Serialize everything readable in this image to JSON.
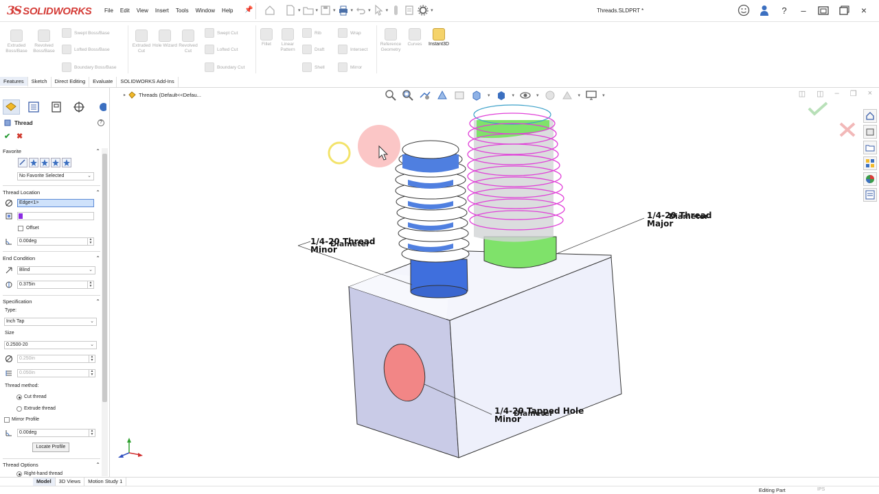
{
  "app": {
    "logo_mark": "3S",
    "logo_text": "SOLIDWORKS",
    "document_title": "Threads.SLDPRT *"
  },
  "menu": [
    "File",
    "Edit",
    "View",
    "Insert",
    "Tools",
    "Window",
    "Help"
  ],
  "command_manager": {
    "extruded_boss": "Extruded Boss/Base",
    "revolved_boss": "Revolved Boss/Base",
    "swept_boss": "Swept Boss/Base",
    "lofted_boss": "Lofted Boss/Base",
    "boundary_boss": "Boundary Boss/Base",
    "extruded_cut": "Extruded Cut",
    "hole_wizard": "Hole Wizard",
    "revolved_cut": "Revolved Cut",
    "swept_cut": "Swept Cut",
    "lofted_cut": "Lofted Cut",
    "boundary_cut": "Boundary Cut",
    "fillet": "Fillet",
    "linear_pattern": "Linear Pattern",
    "rib": "Rib",
    "draft": "Draft",
    "shell": "Shell",
    "wrap": "Wrap",
    "intersect": "Intersect",
    "mirror": "Mirror",
    "reference_geometry": "Reference Geometry",
    "curves": "Curves",
    "instant3d": "Instant3D"
  },
  "tabs": [
    "Features",
    "Sketch",
    "Direct Editing",
    "Evaluate",
    "SOLIDWORKS Add-Ins"
  ],
  "feature_tree": {
    "label": "Threads  (Default<<Defau..."
  },
  "property_manager": {
    "title": "Thread",
    "favorite": {
      "header": "Favorite",
      "select_value": "No Favorite Selected"
    },
    "thread_location": {
      "header": "Thread Location",
      "edge_value": "Edge<1>",
      "offset_label": "Offset",
      "angle_value": "0.00deg"
    },
    "end_condition": {
      "header": "End Condition",
      "type_value": "Blind",
      "depth_value": "0.375in"
    },
    "specification": {
      "header": "Specification",
      "type_label": "Type:",
      "type_value": "Inch Tap",
      "size_label": "Size",
      "size_value": "0.2500-20",
      "diameter_value": "0.250in",
      "pitch_value": "0.050in",
      "method_label": "Thread method:",
      "cut_thread": "Cut thread",
      "extrude_thread": "Extrude thread",
      "mirror_profile": "Mirror Profile",
      "rotation_value": "0.00deg",
      "locate_button": "Locate Profile"
    },
    "thread_options": {
      "header": "Thread Options",
      "right_hand": "Right-hand thread"
    }
  },
  "annotations": {
    "minor_thread_line1": "1/4-20 Thread",
    "minor_thread_line2": "Minor",
    "minor_thread_ghost": "Diameter",
    "major_thread_line1": "1/4-20 Thread",
    "major_thread_line2": "Major",
    "major_thread_ghost": "Diameter",
    "tapped_line1": "1/4-20 Tapped Hole",
    "tapped_line2": "Minor",
    "tapped_ghost": "Diameter"
  },
  "bottom_tabs": [
    "Model",
    "3D Views",
    "Motion Study 1"
  ],
  "status": {
    "text": "Editing Part",
    "units": "IPS"
  },
  "colors": {
    "brand_red": "#d43b36",
    "blue_thread": "#4f7fe0",
    "green_thread": "#7ee36c",
    "magenta_helix": "#e040d8",
    "hole_red": "#f07a7a",
    "block_face": "#eef0fb",
    "block_side": "#c7c9e6"
  }
}
